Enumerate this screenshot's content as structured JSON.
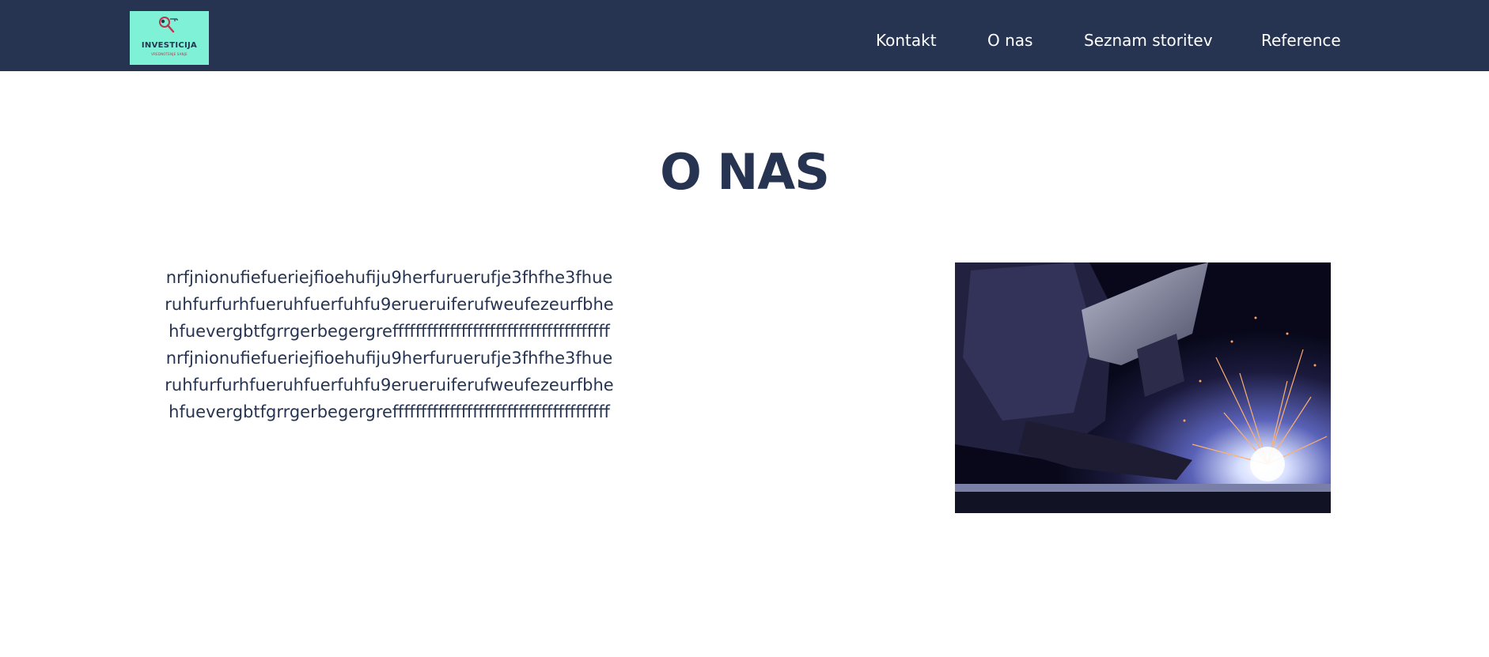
{
  "header": {
    "logo": {
      "name": "INVESTICIJA",
      "tagline": "VREDNOTENJE SANJE",
      "background": "#7ff1d6",
      "icon": "magnifier-key-icon"
    },
    "nav": [
      {
        "label": "Kontakt"
      },
      {
        "label": "O nas"
      },
      {
        "label": "Seznam storitev"
      },
      {
        "label": "Reference"
      }
    ],
    "background": "#263452"
  },
  "main": {
    "title": "O NAS",
    "body": "nrfjnionufiefueriejfioehufiju9herfuruerufje3fhfhe3fhueruhfurfurhfueruhfuerfuhfu9erueruiferufweufezeurfbhehfuevergbtfgrrgerbegergreffffffffffffffffffffffffffffffffffffffnrfjnionufiefueriejfioehufiju9herfuruerufje3fhfhe3fhueruhfurfurhfueruhfuerfuhfu9erueruiferufweufezeurfbhehfuevergbtfgrrgerbegergreffffffffffffffffffffffffffffffffffffff",
    "image": {
      "subject": "welder-with-sparks-photo"
    }
  },
  "colors": {
    "navy": "#263452",
    "white": "#ffffff",
    "mint": "#7ff1d6"
  }
}
